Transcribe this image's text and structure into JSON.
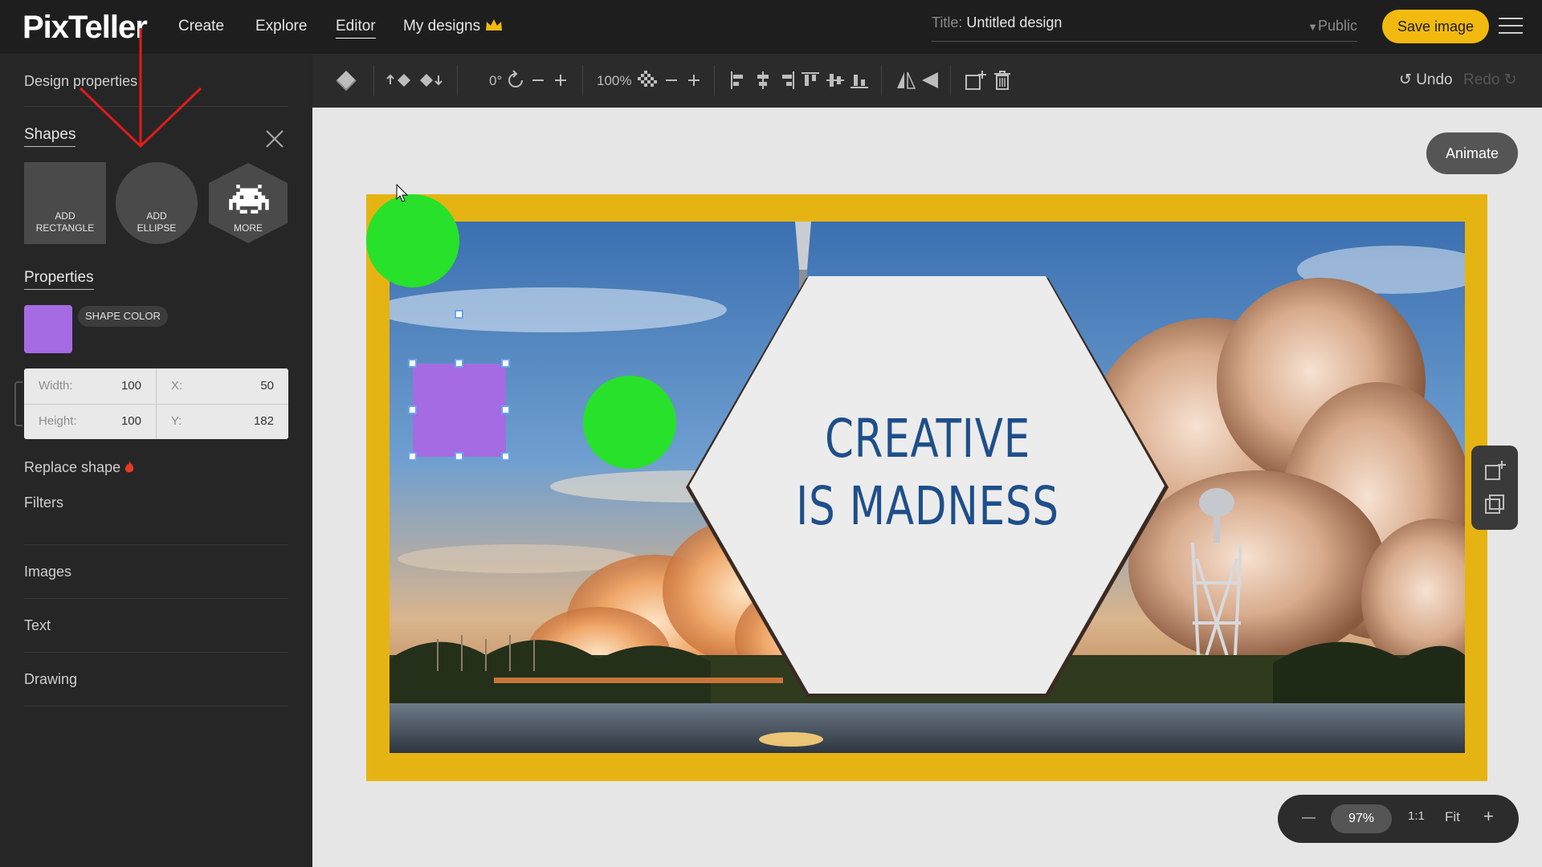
{
  "app": {
    "logo": "PixTeller"
  },
  "nav": {
    "create": "Create",
    "explore": "Explore",
    "editor": "Editor",
    "my_designs": "My designs"
  },
  "title_field": {
    "label": "Title:",
    "value": "Untitled design",
    "visibility": "Public"
  },
  "save_label": "Save image",
  "sidebar": {
    "design_properties": "Design properties",
    "shapes_title": "Shapes",
    "tiles": {
      "rect_l1": "ADD",
      "rect_l2": "RECTANGLE",
      "ell_l1": "ADD",
      "ell_l2": "ELLIPSE",
      "more": "MORE"
    },
    "properties_title": "Properties",
    "shape_color_label": "SHAPE COLOR",
    "shape_color": "#a56be3",
    "width_label": "Width:",
    "width": "100",
    "height_label": "Height:",
    "height": "100",
    "x_label": "X:",
    "x": "50",
    "y_label": "Y:",
    "y": "182",
    "replace_shape": "Replace shape",
    "filters": "Filters",
    "images": "Images",
    "text": "Text",
    "drawing": "Drawing"
  },
  "toolbar": {
    "rotation": "0°",
    "opacity": "100%",
    "undo": "Undo",
    "redo": "Redo"
  },
  "canvas": {
    "animate_label": "Animate",
    "headline_line1": "CREATIVE",
    "headline_line2": "IS MADNESS",
    "accent": "#e6b412",
    "circle_color": "#28e12a"
  },
  "zoom": {
    "percent": "97%",
    "one_to_one": "1:1",
    "fit": "Fit"
  }
}
